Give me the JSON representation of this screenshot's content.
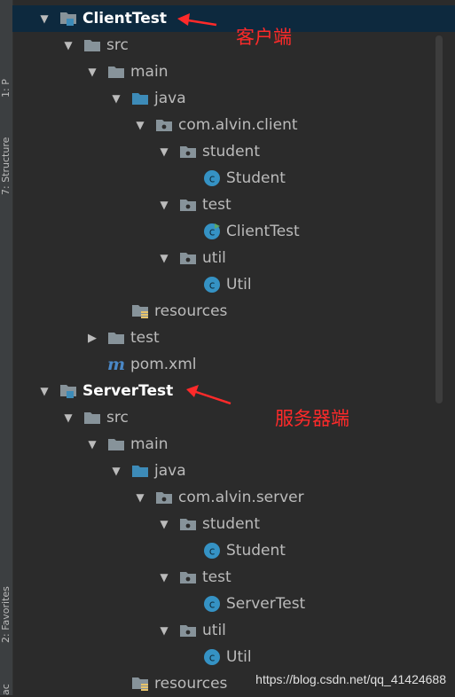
{
  "side_tabs": {
    "project": "1: P",
    "structure": "7: Structure",
    "favorites": "2: Favorites",
    "end": "ac"
  },
  "tree": [
    {
      "label": "ClientTest",
      "type": "module",
      "arrow": "expanded",
      "bold": true,
      "selected": true
    },
    {
      "label": "src",
      "type": "folder",
      "arrow": "expanded"
    },
    {
      "label": "main",
      "type": "folder",
      "arrow": "expanded"
    },
    {
      "label": "java",
      "type": "source-folder",
      "arrow": "expanded"
    },
    {
      "label": "com.alvin.client",
      "type": "package",
      "arrow": "expanded"
    },
    {
      "label": "student",
      "type": "package",
      "arrow": "expanded"
    },
    {
      "label": "Student",
      "type": "class",
      "arrow": "none"
    },
    {
      "label": "test",
      "type": "package",
      "arrow": "expanded"
    },
    {
      "label": "ClientTest",
      "type": "runnable-class",
      "arrow": "none"
    },
    {
      "label": "util",
      "type": "package",
      "arrow": "expanded"
    },
    {
      "label": "Util",
      "type": "class",
      "arrow": "none"
    },
    {
      "label": "resources",
      "type": "resources-folder",
      "arrow": "none"
    },
    {
      "label": "test",
      "type": "folder",
      "arrow": "collapsed"
    },
    {
      "label": "pom.xml",
      "type": "maven-file",
      "arrow": "none"
    },
    {
      "label": "ServerTest",
      "type": "module",
      "arrow": "expanded",
      "bold": true
    },
    {
      "label": "src",
      "type": "folder",
      "arrow": "expanded"
    },
    {
      "label": "main",
      "type": "folder",
      "arrow": "expanded"
    },
    {
      "label": "java",
      "type": "source-folder",
      "arrow": "expanded"
    },
    {
      "label": "com.alvin.server",
      "type": "package",
      "arrow": "expanded"
    },
    {
      "label": "student",
      "type": "package",
      "arrow": "expanded"
    },
    {
      "label": "Student",
      "type": "class",
      "arrow": "none"
    },
    {
      "label": "test",
      "type": "package",
      "arrow": "expanded"
    },
    {
      "label": "ServerTest",
      "type": "class",
      "arrow": "none"
    },
    {
      "label": "util",
      "type": "package",
      "arrow": "expanded"
    },
    {
      "label": "Util",
      "type": "class",
      "arrow": "none"
    },
    {
      "label": "resources",
      "type": "resources-folder",
      "arrow": "none"
    }
  ],
  "annotations": {
    "client": "客户端",
    "server": "服务器端"
  },
  "watermark": "https://blog.csdn.net/qq_41424688",
  "colors": {
    "background": "#2b2b2b",
    "selection": "#0d293e",
    "annotation": "#ff2a2a",
    "folder_icon": "#87939a",
    "source_folder_icon": "#3d8bb8",
    "class_icon": "#3592c4"
  }
}
